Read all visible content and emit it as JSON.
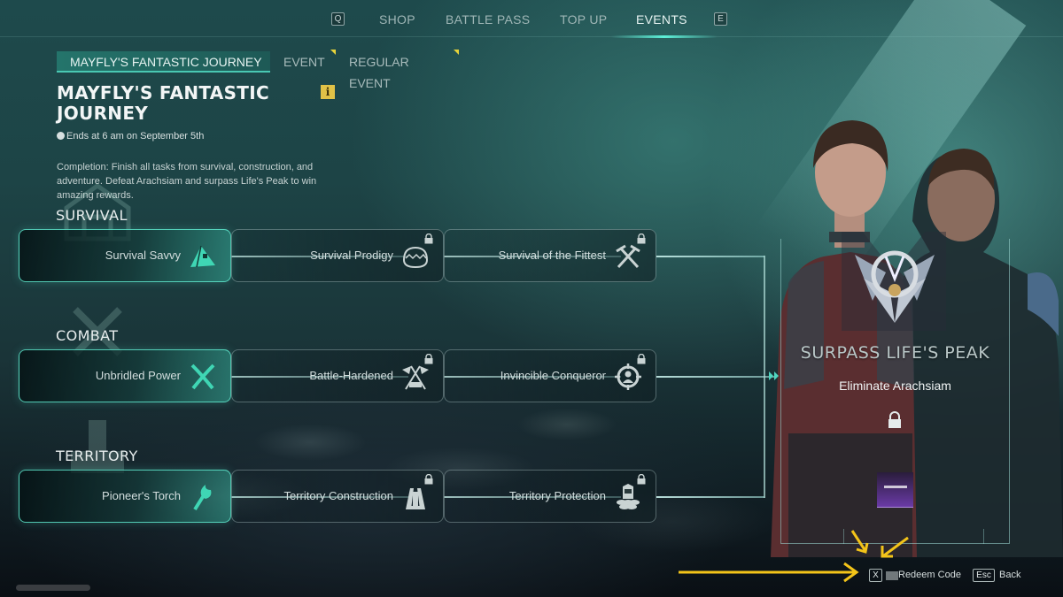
{
  "top_nav": {
    "prev_key": "Q",
    "next_key": "E",
    "tabs": [
      {
        "label": "SHOP",
        "active": false
      },
      {
        "label": "BATTLE PASS",
        "active": false
      },
      {
        "label": "TOP UP",
        "active": false
      },
      {
        "label": "EVENTS",
        "active": true
      }
    ]
  },
  "sub_tabs": [
    {
      "label": "MAYFLY'S FANTASTIC JOURNEY",
      "active": true,
      "has_notice": false
    },
    {
      "label": "EVENT",
      "active": false,
      "has_notice": true
    },
    {
      "label": "REGULAR EVENT",
      "active": false,
      "has_notice": true
    }
  ],
  "event": {
    "title": "MAYFLY'S FANTASTIC JOURNEY",
    "info_icon": "i",
    "ends_text": "Ends at 6 am on September 5th",
    "description": "Completion: Finish all tasks from survival, construction, and adventure. Defeat Arachsiam and surpass Life's Peak to win amazing rewards."
  },
  "categories": [
    {
      "label": "SURVIVAL",
      "tasks": [
        {
          "label": "Survival Savvy",
          "icon": "tent-icon",
          "completed": true,
          "locked": false
        },
        {
          "label": "Survival Prodigy",
          "icon": "mouth-trap-icon",
          "completed": false,
          "locked": true
        },
        {
          "label": "Survival of the Fittest",
          "icon": "crossed-pickaxes-icon",
          "completed": false,
          "locked": true
        }
      ]
    },
    {
      "label": "COMBAT",
      "tasks": [
        {
          "label": "Unbridled Power",
          "icon": "crossed-blades-icon",
          "completed": true,
          "locked": false
        },
        {
          "label": "Battle-Hardened",
          "icon": "crossed-flags-icon",
          "completed": false,
          "locked": true
        },
        {
          "label": "Invincible Conqueror",
          "icon": "crosshair-target-icon",
          "completed": false,
          "locked": true
        }
      ]
    },
    {
      "label": "TERRITORY",
      "tasks": [
        {
          "label": "Pioneer's Torch",
          "icon": "torch-icon",
          "completed": true,
          "locked": false
        },
        {
          "label": "Territory Construction",
          "icon": "tower-structure-icon",
          "completed": false,
          "locked": true
        },
        {
          "label": "Territory Protection",
          "icon": "watchtower-sandbags-icon",
          "completed": false,
          "locked": true
        }
      ]
    }
  ],
  "final_reward": {
    "title": "SURPASS LIFE'S PEAK",
    "subtitle": "Eliminate Arachsiam",
    "locked": true
  },
  "footer_hints": [
    {
      "key": "X",
      "label": "Redeem Code",
      "icon": "barcode-icon"
    },
    {
      "key": "Esc",
      "label": "Back"
    }
  ],
  "colors": {
    "accent_teal": "#49c8b3",
    "completed_icon": "#3fd6b4",
    "notice_yellow": "#e7d33a",
    "info_yellow": "#e1c247",
    "annotation_arrow": "#f3c419"
  }
}
